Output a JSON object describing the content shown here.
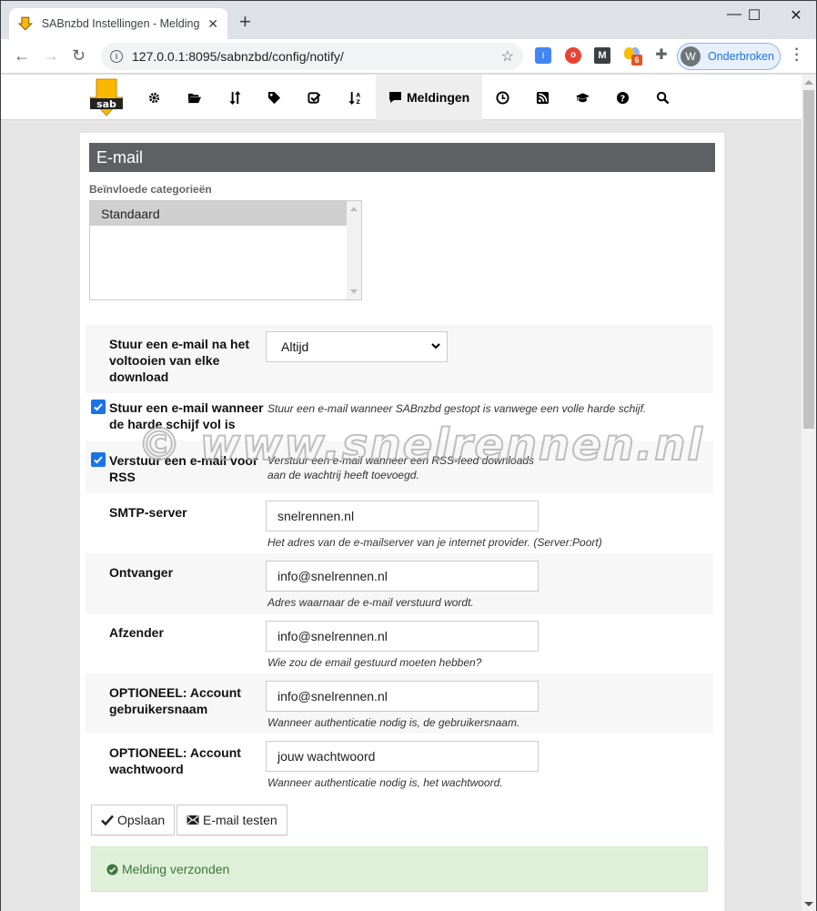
{
  "browser": {
    "tab_title": "SABnzbd Instellingen - Meldingen",
    "url": "127.0.0.1:8095/sabnzbd/config/notify/",
    "profile_initial": "W",
    "profile_label": "Onderbroken",
    "extension_badge": "6",
    "window_controls": {
      "minimize": "—",
      "maximize": "☐",
      "close": "✕"
    }
  },
  "nav": {
    "items": [
      {
        "name": "config",
        "icon": "gear-icon"
      },
      {
        "name": "folders",
        "icon": "folder-open-icon"
      },
      {
        "name": "switches",
        "icon": "sort-icon"
      },
      {
        "name": "categories",
        "icon": "tag-icon"
      },
      {
        "name": "sorting",
        "icon": "check-square-icon"
      },
      {
        "name": "sort-az",
        "icon": "sort-az-icon"
      },
      {
        "name": "notifications",
        "icon": "comment-icon",
        "label": "Meldingen",
        "active": true
      },
      {
        "name": "scheduling",
        "icon": "clock-icon"
      },
      {
        "name": "rss",
        "icon": "rss-icon"
      },
      {
        "name": "special",
        "icon": "graduation-cap-icon"
      },
      {
        "name": "help",
        "icon": "question-circle-icon"
      },
      {
        "name": "search",
        "icon": "search-icon"
      }
    ],
    "active_label": "Meldingen"
  },
  "section": {
    "title": "E-mail",
    "categories_label": "Beïnvloede categorieën",
    "categories_options": [
      "Standaard"
    ]
  },
  "form": {
    "email_on_complete": {
      "label": "Stuur een e-mail na het voltooien van elke download",
      "value": "Altijd"
    },
    "email_disk_full": {
      "label": "Stuur een e-mail wanneer de harde schijf vol is",
      "checked": true,
      "desc": "Stuur een e-mail wanneer SABnzbd gestopt is vanwege een volle harde schijf."
    },
    "email_rss": {
      "label": "Verstuur een e-mail voor RSS",
      "checked": true,
      "desc_line1": "Verstuur een e-mail wanneer een RSS-feed downloads",
      "desc_line2": "aan de wachtrij heeft toevoegd."
    },
    "smtp_server": {
      "label": "SMTP-server",
      "value": "snelrennen.nl",
      "desc": "Het adres van de e-mailserver van je internet provider. (Server:Poort)"
    },
    "recipient": {
      "label": "Ontvanger",
      "value": "info@snelrennen.nl",
      "desc": "Adres waarnaar de e-mail verstuurd wordt."
    },
    "sender": {
      "label": "Afzender",
      "value": "info@snelrennen.nl",
      "desc": "Wie zou de email gestuurd moeten hebben?"
    },
    "account_user": {
      "label": "OPTIONEEL: Account gebruikersnaam",
      "value": "info@snelrennen.nl",
      "desc": "Wanneer authenticatie nodig is, de gebruikersnaam."
    },
    "account_pass": {
      "label": "OPTIONEEL: Account wachtwoord",
      "value": "jouw wachtwoord",
      "desc": "Wanneer authenticatie nodig is, het wachtwoord."
    }
  },
  "buttons": {
    "save": "Opslaan",
    "test": "E-mail testen"
  },
  "alert": {
    "message": "Melding verzonden"
  },
  "watermark": "© www.snelrennen.nl",
  "colors": {
    "section_header": "#5e6064",
    "alert_bg": "#dff0d8",
    "alert_text": "#3c763d",
    "checkbox": "#1a73e8",
    "sab_yellow": "#fbb800"
  }
}
